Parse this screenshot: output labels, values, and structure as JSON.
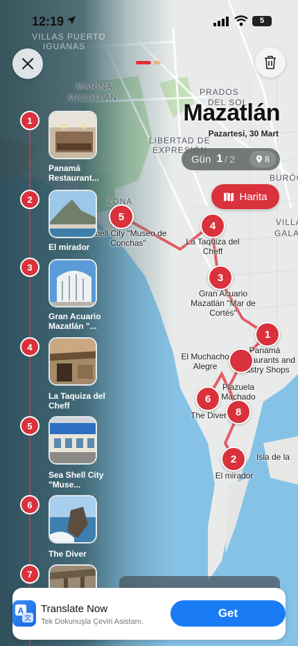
{
  "status_bar": {
    "time": "12:19",
    "battery": "5"
  },
  "header": {
    "city": "Mazatlán",
    "date": "Pazartesi, 30 Mart",
    "day_label": "Gün",
    "day_current": "1",
    "day_sep": "/",
    "day_total": "2",
    "stop_count": "8",
    "map_button": "Harita"
  },
  "map_labels": {
    "streets": [
      "VILLAS PUERTO",
      "IGUANAS",
      "MARINA",
      "MAZATLÁN",
      "PRADOS",
      "DEL SOL",
      "LIBERTAD DE",
      "EXPRESIÓN",
      "ZONA",
      "BURÓC",
      "VILLA",
      "GALAX"
    ],
    "pins": [
      {
        "num": "5",
        "label": "Shell City \"Museo de Conchas\""
      },
      {
        "num": "4",
        "label": "La Taquiza del Cheff"
      },
      {
        "num": "3",
        "label": "Gran Acuario Mazatlán \"Mar de Cortés\""
      },
      {
        "num": "1",
        "label": "Panamá Restaurants and Pastry Shops"
      },
      {
        "num": "7",
        "label": "El Muchacho Alegre"
      },
      {
        "num": "8",
        "label": "Plazuela Machado"
      },
      {
        "num": "6",
        "label": "The Diver"
      },
      {
        "num": "2",
        "label": "El mirador"
      }
    ],
    "island": "Isla de la"
  },
  "stops": [
    {
      "num": "1",
      "name": "Panamá Restaurant..."
    },
    {
      "num": "2",
      "name": "El mirador"
    },
    {
      "num": "3",
      "name": "Gran Acuario Mazatlán \"..."
    },
    {
      "num": "4",
      "name": "La Taquiza del Cheff"
    },
    {
      "num": "5",
      "name": "Sea Shell City \"Muse..."
    },
    {
      "num": "6",
      "name": "The Diver"
    },
    {
      "num": "7",
      "name": ""
    }
  ],
  "banner": {
    "app_name": "Translate Now",
    "app_subtitle": "Tek Dokunuşla Çeviri Asistanı.",
    "get_label": "Get"
  },
  "colors": {
    "accent": "#d9323d",
    "get_button": "#1a7cf5"
  }
}
